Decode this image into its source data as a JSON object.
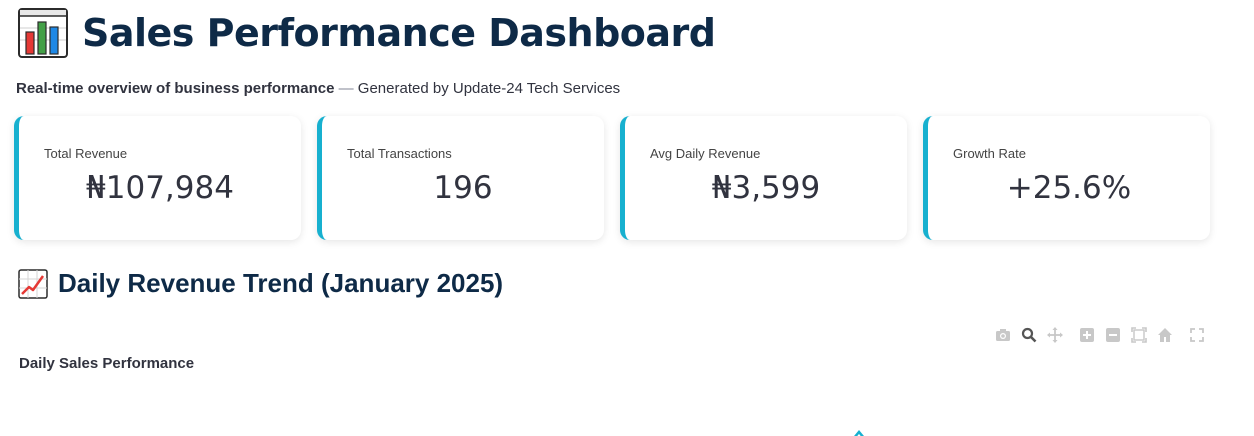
{
  "header": {
    "title_icon": "bar-chart-emoji-icon",
    "title": "Sales Performance Dashboard",
    "subtitle_bold": "Real-time overview of business performance",
    "subtitle_dash": "—",
    "subtitle_rest": "Generated by Update-24 Tech Services"
  },
  "kpis": [
    {
      "label": "Total Revenue",
      "value": "₦107,984"
    },
    {
      "label": "Total Transactions",
      "value": "196"
    },
    {
      "label": "Avg Daily Revenue",
      "value": "₦3,599"
    },
    {
      "label": "Growth Rate",
      "value": "+25.6%"
    }
  ],
  "section": {
    "icon": "chart-increasing-emoji-icon",
    "title": "Daily Revenue Trend (January 2025)"
  },
  "toolbar": {
    "icons": [
      "camera-icon",
      "zoom-icon",
      "pan-icon",
      "zoom-in-icon",
      "zoom-out-icon",
      "autoscale-icon",
      "reset-axes-icon",
      "fullscreen-icon"
    ]
  },
  "chart": {
    "title": "Daily Sales Performance"
  },
  "colors": {
    "accent": "#17b0cf",
    "title": "#0e2a47",
    "toolbar_icon": "#c8c8c8"
  }
}
